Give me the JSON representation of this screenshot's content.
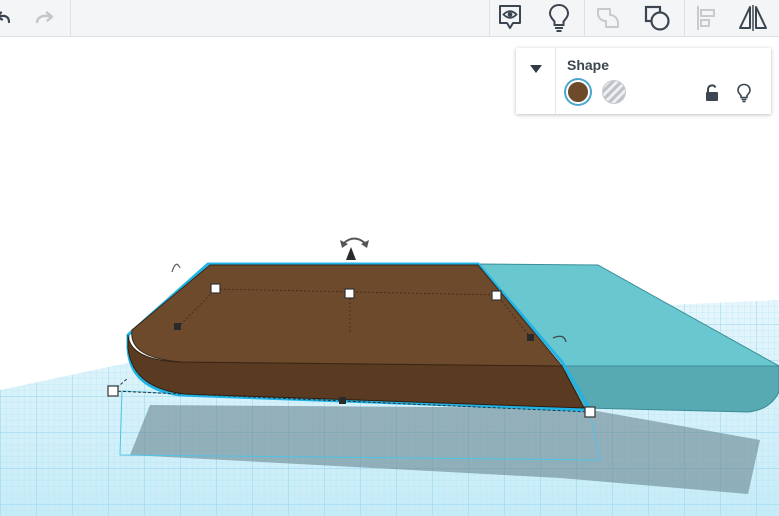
{
  "toolbar": {
    "left": [
      {
        "name": "undo-button",
        "icon": "undo-icon"
      },
      {
        "name": "redo-button",
        "icon": "redo-icon"
      }
    ],
    "right": [
      {
        "name": "view-comments-button",
        "icon": "eye-speech-icon"
      },
      {
        "name": "show-all-button",
        "icon": "lightbulb-icon"
      },
      {
        "name": "group-button",
        "icon": "group-shape-icon"
      },
      {
        "name": "ungroup-button",
        "icon": "ungroup-shape-icon"
      },
      {
        "name": "align-button",
        "icon": "align-icon"
      },
      {
        "name": "mirror-button",
        "icon": "mirror-icon"
      }
    ]
  },
  "inspector": {
    "title": "Shape",
    "solid_color": "#6e4a2d",
    "hole_option": "hole-swatch",
    "lock_icon": "unlock-icon",
    "visibility_icon": "lightbulb-icon",
    "collapse_icon": "caret-down-icon"
  },
  "scene": {
    "selected_shape_color": "#6e4a2d",
    "other_shape_color": "#69c7cf",
    "selection_outline_color": "#1fb3e6",
    "grid_color": "#aee4f4",
    "handles": [
      "rotate-handle",
      "lift-handle",
      "resize-handles"
    ]
  }
}
